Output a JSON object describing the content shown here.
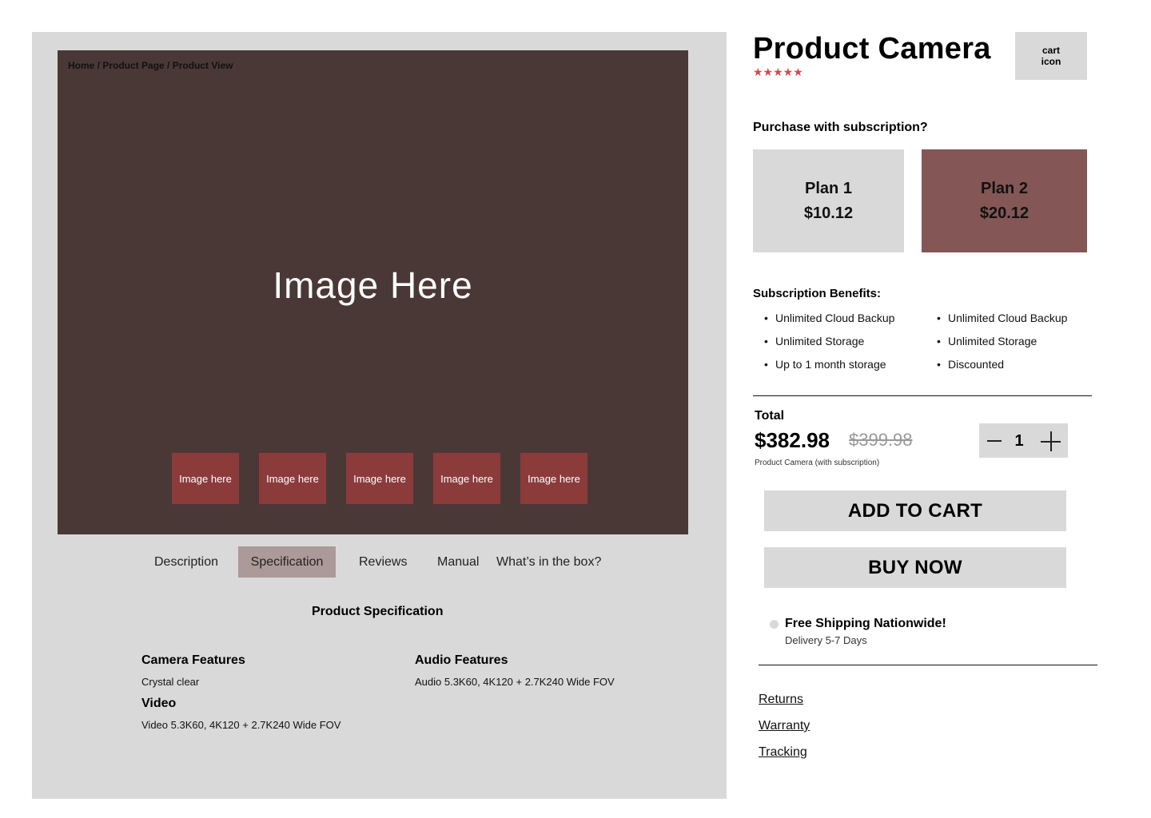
{
  "breadcrumb": "Home / Product Page / Product View",
  "gallery": {
    "main_image_label": "Image Here",
    "thumbnails": [
      "Image here",
      "Image here",
      "Image here",
      "Image here",
      "Image here"
    ]
  },
  "tabs": [
    "Description",
    "Specification",
    "Reviews",
    "Manual",
    "What’s in the box?"
  ],
  "active_tab": "Specification",
  "specification": {
    "title": "Product Specification",
    "camera_features": {
      "heading": "Camera Features",
      "text": "Crystal clear"
    },
    "video": {
      "heading": "Video",
      "text": "Video 5.3K60, 4K120 + 2.7K240 Wide FOV"
    },
    "audio_features": {
      "heading": "Audio Features",
      "text": "Audio 5.3K60, 4K120 + 2.7K240 Wide FOV"
    }
  },
  "product": {
    "title": "Product Camera",
    "rating_stars": "★★★★★",
    "rating": 5
  },
  "cart": {
    "line1": "cart",
    "line2": "icon"
  },
  "subscription": {
    "question": "Purchase with subscription?",
    "plans": [
      {
        "name": "Plan 1",
        "price": "$10.12"
      },
      {
        "name": "Plan 2",
        "price": "$20.12"
      }
    ],
    "selected_plan": "Plan 2",
    "benefits_title": "Subscription Benefits:",
    "benefits_plan1": [
      "Unlimited Cloud Backup",
      "Unlimited Storage",
      "Up to 1 month storage"
    ],
    "benefits_plan2": [
      "Unlimited Cloud Backup",
      "Unlimited Storage",
      "Discounted"
    ]
  },
  "total": {
    "label": "Total",
    "price": "$382.98",
    "original_price": "$399.98",
    "note": "Product Camera (with subscription)"
  },
  "quantity": {
    "value": "1"
  },
  "buttons": {
    "add_to_cart": "ADD TO CART",
    "buy_now": "BUY NOW"
  },
  "shipping": {
    "title": "Free Shipping Nationwide!",
    "subtitle": "Delivery 5-7 Days"
  },
  "links": [
    "Returns",
    "Warranty",
    "Tracking"
  ],
  "colors": {
    "panel_bg": "#d9d9d9",
    "hero_bg": "#4a3837",
    "thumb_bg": "#8c3b3b",
    "active_tab_bg": "#ab9a98",
    "selected_plan_bg": "#845656",
    "star_color": "#d24b4b"
  }
}
